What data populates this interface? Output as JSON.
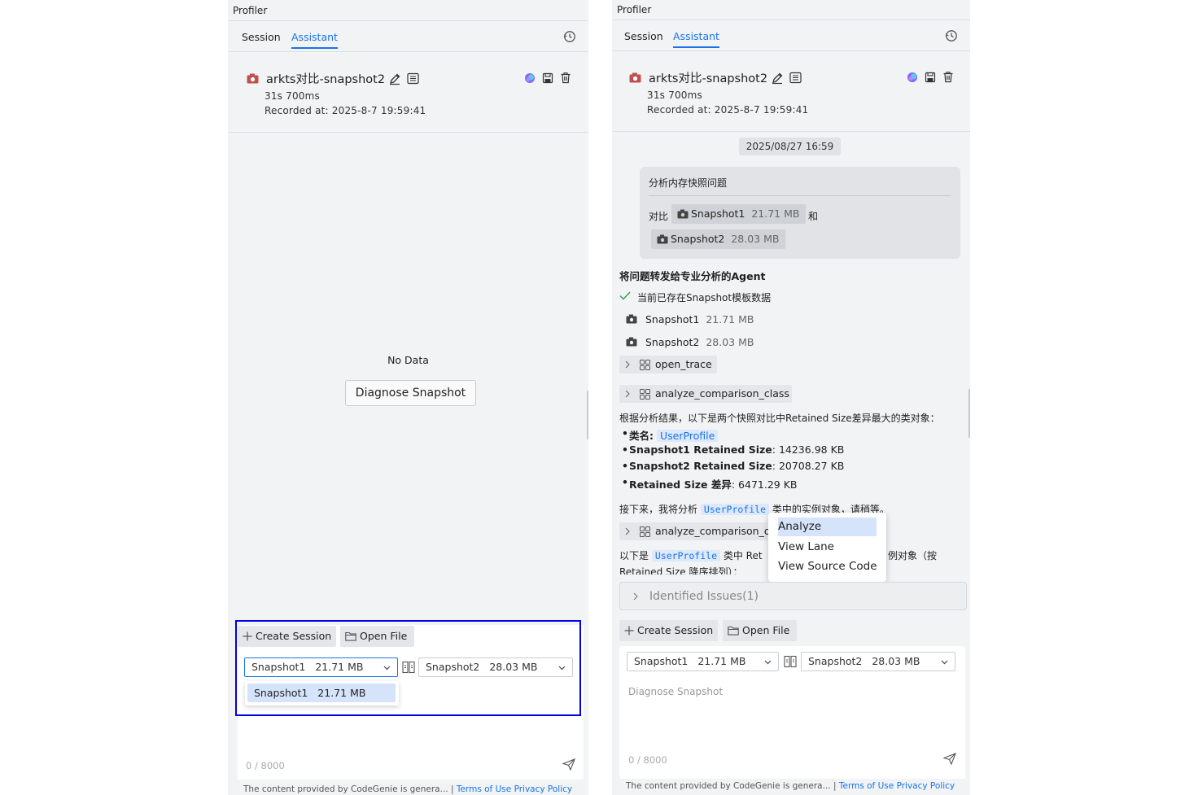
{
  "app": {
    "title": "Profiler"
  },
  "tabs": [
    {
      "label": "Session"
    },
    {
      "label": "Assistant"
    }
  ],
  "snapshot": {
    "name": "arkts对比-snapshot2",
    "duration": "31s 700ms",
    "recorded": "Recorded at: 2025-8-7 19:59:41"
  },
  "left": {
    "no_data": "No Data",
    "diagnose_button": "Diagnose Snapshot",
    "dropdown_option": "Snapshot1   21.71 MB"
  },
  "toolbar": {
    "create_session": "Create Session",
    "open_file": "Open File"
  },
  "selects": {
    "first": {
      "name": "Snapshot1",
      "size": "21.71 MB"
    },
    "second": {
      "name": "Snapshot2",
      "size": "28.03 MB"
    }
  },
  "input": {
    "placeholder": "Diagnose Snapshot",
    "counter": "0 / 8000"
  },
  "footer": {
    "notice": "The content provided by CodeGenie is genera...",
    "sep": "|",
    "terms": "Terms of Use",
    "privacy": "Privacy Policy"
  },
  "chat": {
    "timestamp": "2025/08/27 16:59",
    "user_title": "分析内存快照问题",
    "compare_prefix": "对比",
    "compare_and": "和",
    "chips": [
      {
        "name": "Snapshot1",
        "size": "21.71 MB"
      },
      {
        "name": "Snapshot2",
        "size": "28.03 MB"
      }
    ],
    "agent_heading": "将问题转发给专业分析的Agent",
    "check_text": "当前已存在Snapshot模板数据",
    "snapshots": [
      {
        "name": "Snapshot1",
        "size": "21.71 MB"
      },
      {
        "name": "Snapshot2",
        "size": "28.03 MB"
      }
    ],
    "tools": [
      "open_trace",
      "analyze_comparison_class",
      "analyze_comparison_o"
    ],
    "result_intro": "根据分析结果，以下是两个快照对比中Retained Size差异最大的类对象：",
    "bullets": {
      "class_label": "类名:",
      "class_value": "UserProfile",
      "s1_label": "Snapshot1 Retained Size",
      "s1_value": ": 14236.98 KB",
      "s2_label": "Snapshot2 Retained Size",
      "s2_value": ": 20708.27 KB",
      "diff_label": "Retained Size 差异",
      "diff_value": ": 6471.29 KB"
    },
    "next_prefix": "接下来，我将分析",
    "next_code": "UserProfile",
    "next_suffix": "类中的实例对象，请稍等。",
    "below_prefix": "以下是",
    "below_code": "UserProfile",
    "below_mid": "类中 Ret",
    "below_tail": "例对象（按",
    "below_line2": "Retained Size 降序排列）："
  },
  "context_menu": [
    "Analyze",
    "View Lane",
    "View Source Code"
  ],
  "issues": {
    "label": "Identified Issues(1)"
  },
  "colors": {
    "accent": "#1a73e8",
    "highlight_border": "#0000e6",
    "panel_bg": "#f1f3f5"
  }
}
